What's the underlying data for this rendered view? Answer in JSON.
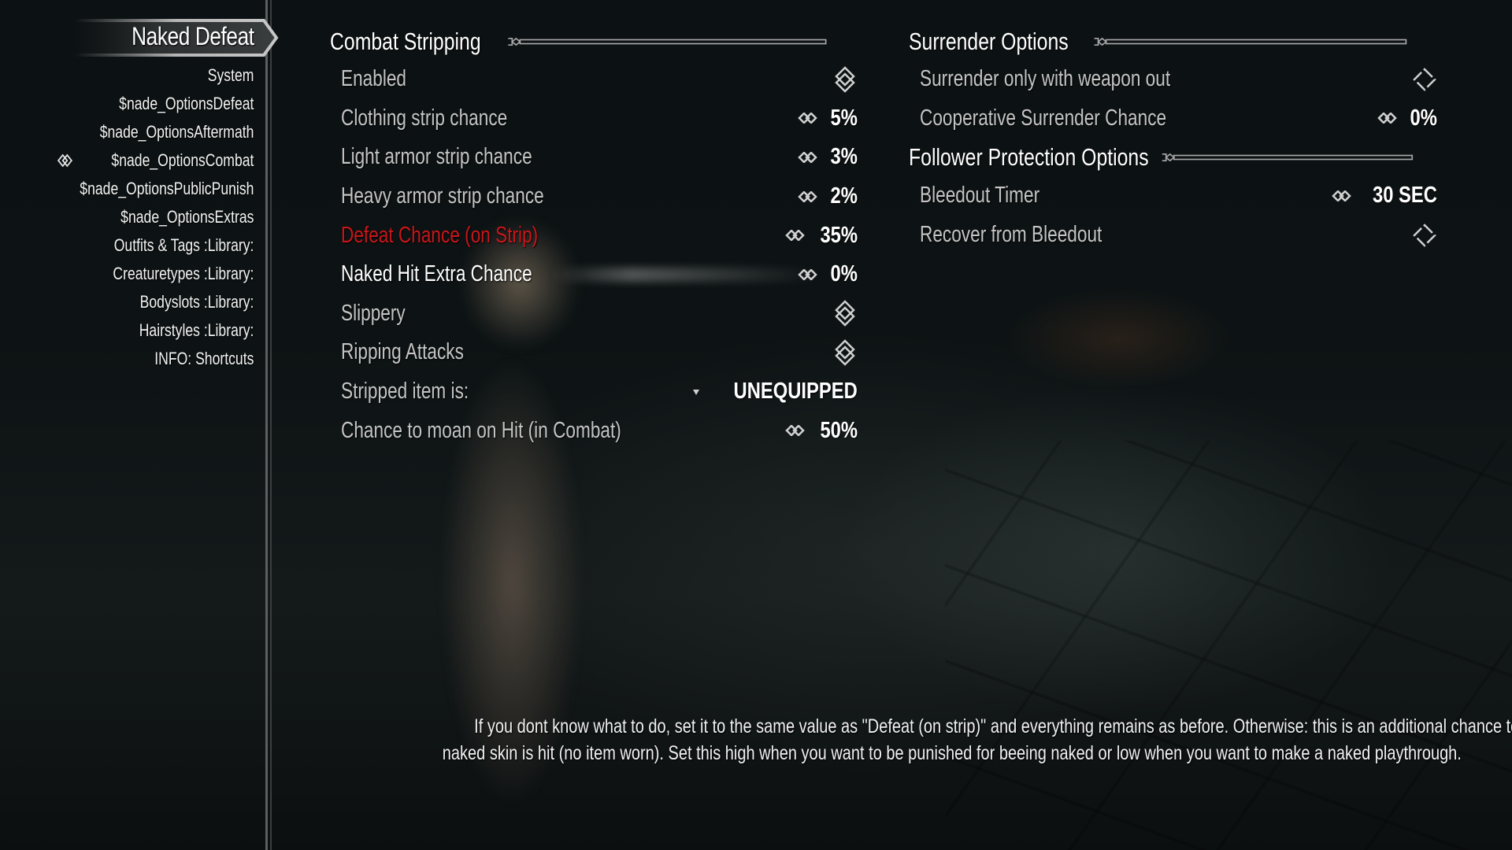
{
  "sidebar": {
    "title": "Naked Defeat",
    "items": [
      {
        "label": "System",
        "selected": false
      },
      {
        "label": "$nade_OptionsDefeat",
        "selected": false
      },
      {
        "label": "$nade_OptionsAftermath",
        "selected": false
      },
      {
        "label": "$nade_OptionsCombat",
        "selected": true
      },
      {
        "label": "$nade_OptionsPublicPunish",
        "selected": false
      },
      {
        "label": "$nade_OptionsExtras",
        "selected": false
      },
      {
        "label": "Outfits & Tags :Library:",
        "selected": false
      },
      {
        "label": "Creaturetypes :Library:",
        "selected": false
      },
      {
        "label": "Bodyslots :Library:",
        "selected": false
      },
      {
        "label": "Hairstyles :Library:",
        "selected": false
      },
      {
        "label": "INFO: Shortcuts",
        "selected": false
      }
    ]
  },
  "left_column": {
    "header": "Combat Stripping",
    "rows": [
      {
        "label": "Enabled",
        "type": "toggle",
        "checked": true
      },
      {
        "label": "Clothing strip chance",
        "type": "slider",
        "value": "5%"
      },
      {
        "label": "Light armor strip chance",
        "type": "slider",
        "value": "3%"
      },
      {
        "label": "Heavy armor strip chance",
        "type": "slider",
        "value": "2%"
      },
      {
        "label": "Defeat Chance (on Strip)",
        "type": "slider",
        "value": "35%",
        "style": "red"
      },
      {
        "label": "Naked Hit Extra Chance",
        "type": "slider",
        "value": "0%",
        "style": "highlighted"
      },
      {
        "label": "Slippery",
        "type": "toggle",
        "checked": true
      },
      {
        "label": "Ripping Attacks",
        "type": "toggle",
        "checked": true
      },
      {
        "label": "Stripped item is:",
        "type": "menu",
        "value": "UNEQUIPPED"
      },
      {
        "label": "Chance to moan on Hit (in Combat)",
        "type": "slider",
        "value": "50%"
      }
    ]
  },
  "right_column": {
    "sections": [
      {
        "header": "Surrender Options",
        "rows": [
          {
            "label": "Surrender only with weapon out",
            "type": "toggle",
            "checked": false
          },
          {
            "label": "Cooperative Surrender Chance",
            "type": "slider",
            "value": "0%"
          }
        ]
      },
      {
        "header": "Follower Protection Options",
        "rows": [
          {
            "label": "Bleedout Timer",
            "type": "slider",
            "value": "30 SEC"
          },
          {
            "label": "Recover from Bleedout",
            "type": "toggle",
            "checked": false
          }
        ]
      }
    ]
  },
  "info": {
    "line1": "If you dont know what to do, set it to the same value as \"Defeat (on strip)\" and everything remains as before. Otherwise: this is an additional chance to get defeated on beeing hit when",
    "line2": "naked skin is hit (no item worn). Set this high when you want to be punished for beeing naked or low when you want to make a naked playthrough."
  },
  "colors": {
    "text": "#c4c4c4",
    "highlight": "#ffffff",
    "red": "#c8161a",
    "ornament": "#a8a8a8"
  }
}
